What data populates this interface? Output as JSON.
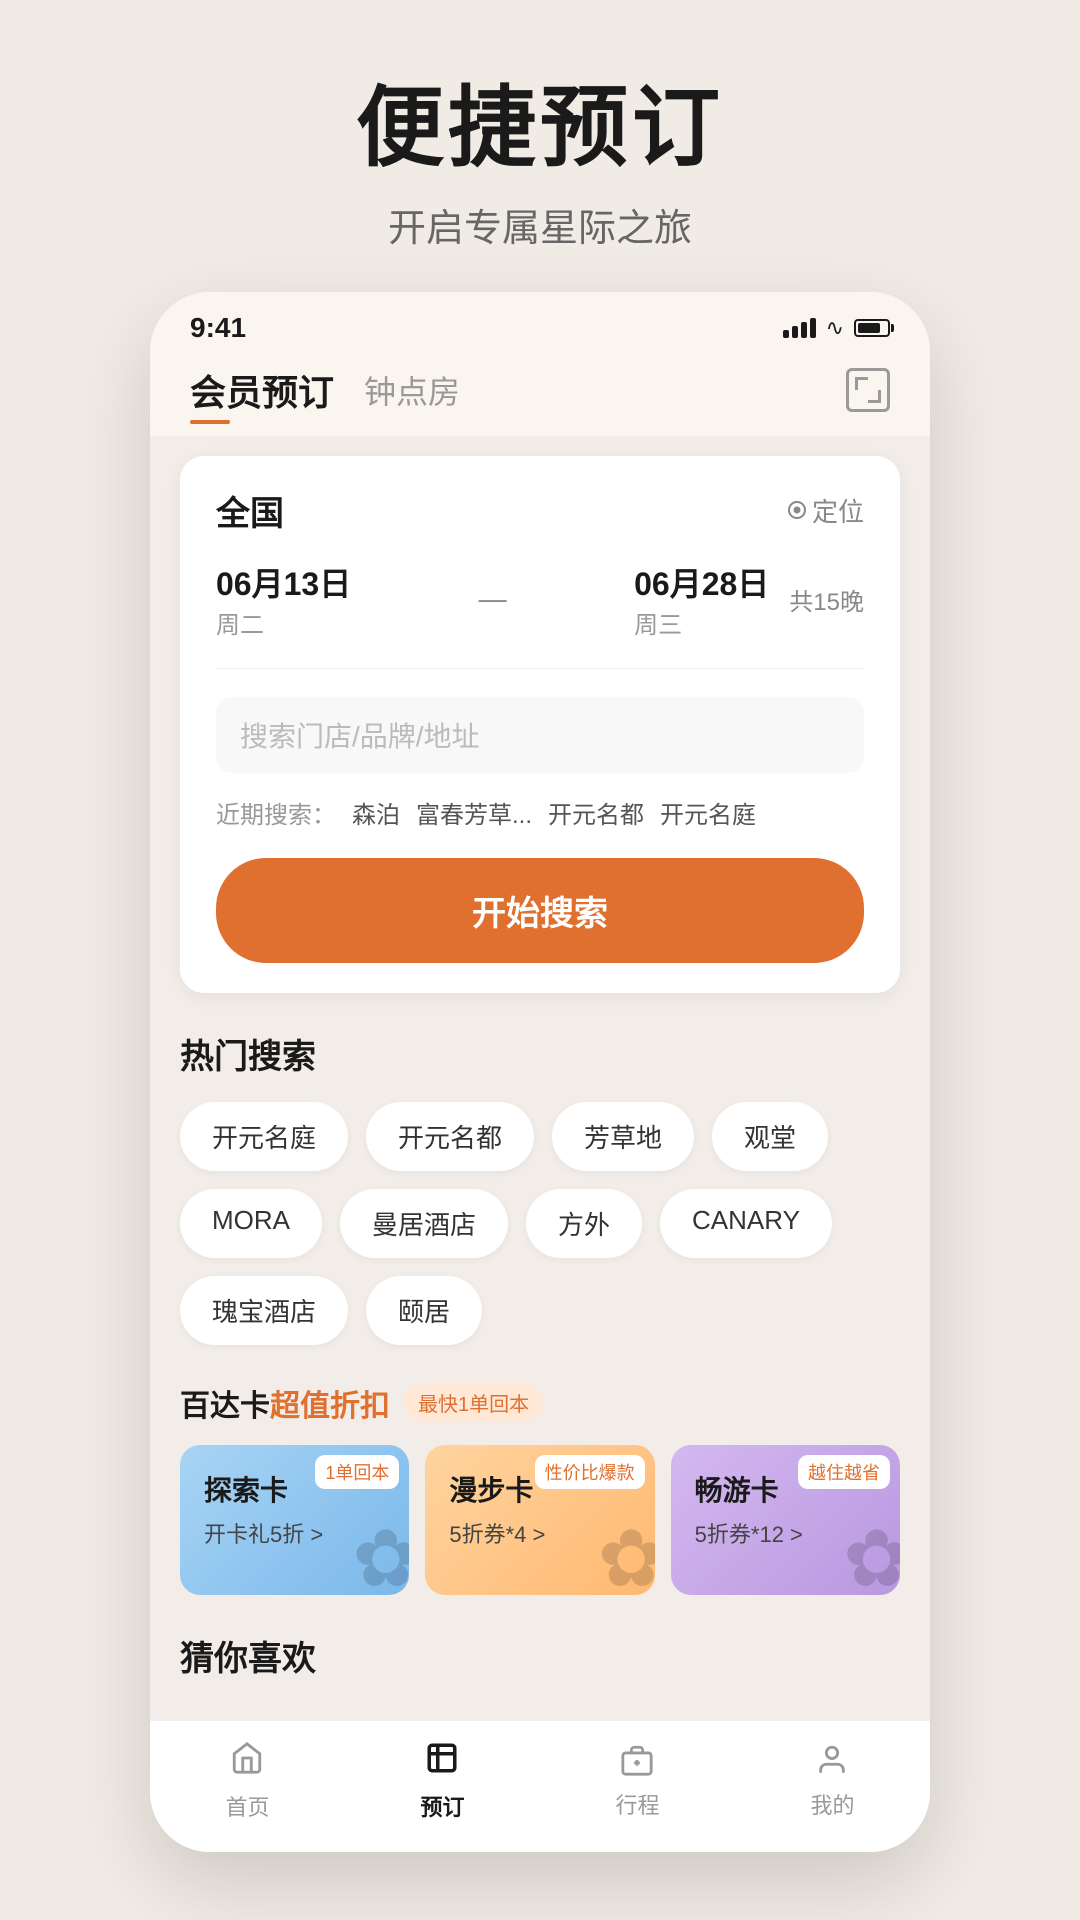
{
  "hero": {
    "title": "便捷预订",
    "subtitle": "开启专属星际之旅"
  },
  "statusBar": {
    "time": "9:41"
  },
  "header": {
    "tab_active": "会员预订",
    "tab_inactive": "钟点房"
  },
  "search": {
    "location": "全国",
    "location_btn": "定位",
    "date_from": "06月13日",
    "date_from_day": "周二",
    "date_to": "06月28日",
    "date_to_day": "周三",
    "nights": "共15晚",
    "arrow": "—",
    "placeholder": "搜索门店/品牌/地址",
    "recent_label": "近期搜索：",
    "recent_items": [
      "森泊",
      "富春芳草...",
      "开元名都",
      "开元名庭"
    ],
    "search_btn": "开始搜索"
  },
  "hotSearch": {
    "title": "热门搜索",
    "tags": [
      "开元名庭",
      "开元名都",
      "芳草地",
      "观堂",
      "MORA",
      "曼居酒店",
      "方外",
      "CANARY",
      "瑰宝酒店",
      "颐居"
    ]
  },
  "badaCard": {
    "title": "百达卡",
    "highlight": "超值折扣",
    "badge": "最快1单回本",
    "cards": [
      {
        "label": "1单回本",
        "name": "探索卡",
        "desc": "开卡礼5折 >"
      },
      {
        "label": "性价比爆款",
        "name": "漫步卡",
        "desc": "5折券*4 >"
      },
      {
        "label": "越住越省",
        "name": "畅游卡",
        "desc": "5折券*12 >"
      }
    ]
  },
  "guessSection": {
    "title": "猜你喜欢"
  },
  "bottomNav": {
    "items": [
      {
        "label": "首页",
        "active": false
      },
      {
        "label": "预订",
        "active": true
      },
      {
        "label": "行程",
        "active": false
      },
      {
        "label": "我的",
        "active": false
      }
    ]
  }
}
